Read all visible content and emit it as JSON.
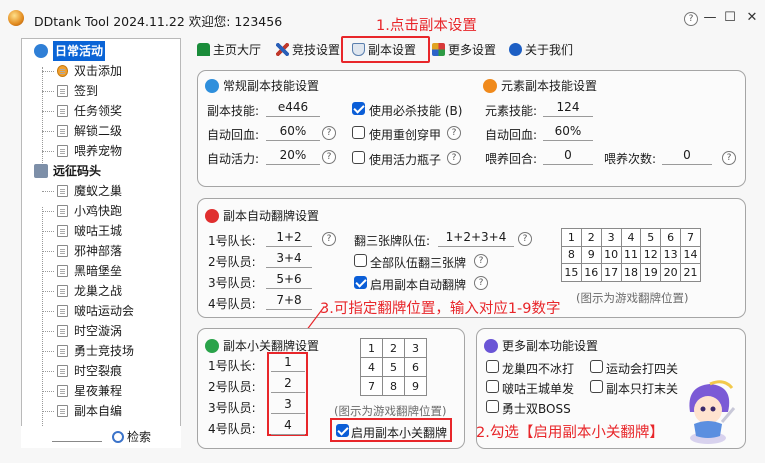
{
  "window": {
    "title": "DDtank Tool 2024.11.22 欢迎您: 123456",
    "help_glyph": "?",
    "minimize_glyph": "—",
    "maximize_glyph": "☐",
    "close_glyph": "✕"
  },
  "annotations": {
    "step1": "1.点击副本设置",
    "step2": "2.勾选【启用副本小关翻牌】",
    "step3": "3.可指定翻牌位置，输入对应1-9数字"
  },
  "sidebar": {
    "groups": [
      {
        "label": "日常活动",
        "selected": true,
        "items": [
          "双击添加",
          "签到",
          "任务领奖",
          "解锁二级",
          "喂养宠物"
        ]
      },
      {
        "label": "远征码头",
        "selected": false,
        "items": [
          "魔蚁之巢",
          "小鸡快跑",
          "啵咕王城",
          "邪神部落",
          "黑暗堡垒",
          "龙巢之战",
          "啵咕运动会",
          "时空漩涡",
          "勇士竞技场",
          "时空裂痕",
          "星夜兼程",
          "副本自编"
        ]
      }
    ],
    "search_label": "检索"
  },
  "tabs": [
    {
      "label": "主页大厅",
      "icon": "home-icon",
      "color": "#1a8c3a"
    },
    {
      "label": "竞技设置",
      "icon": "crossed-swords-icon",
      "color": "#2a5fb8"
    },
    {
      "label": "副本设置",
      "icon": "ship-icon",
      "color": "#5a7fae",
      "active": true
    },
    {
      "label": "更多设置",
      "icon": "grid-icon",
      "color": "#4a4a4a"
    },
    {
      "label": "关于我们",
      "icon": "info-icon",
      "color": "#1d5fc4"
    }
  ],
  "regular_skills": {
    "title": "常规副本技能设置",
    "skill_label": "副本技能:",
    "skill_value": "e446",
    "auto_hp_label": "自动回血:",
    "auto_hp_value": "60%",
    "auto_energy_label": "自动活力:",
    "auto_energy_value": "20%",
    "use_kill_skill": {
      "label": "使用必杀技能 (B)",
      "checked": true
    },
    "use_armor_pierce": {
      "label": "使用重创穿甲",
      "checked": false
    },
    "use_energy_bottle": {
      "label": "使用活力瓶子",
      "checked": false
    }
  },
  "element_skills": {
    "title": "元素副本技能设置",
    "skill_label": "元素技能:",
    "skill_value": "124",
    "auto_hp_label": "自动回血:",
    "auto_hp_value": "60%",
    "feed_round_label": "喂养回合:",
    "feed_round_value": "0",
    "feed_count_label": "喂养次数:",
    "feed_count_value": "0"
  },
  "auto_flip": {
    "title": "副本自动翻牌设置",
    "rows": [
      {
        "label": "1号队长:",
        "value": "1+2"
      },
      {
        "label": "2号队员:",
        "value": "3+4"
      },
      {
        "label": "3号队员:",
        "value": "5+6"
      },
      {
        "label": "4号队员:",
        "value": "7+8"
      }
    ],
    "triple_label": "翻三张牌队伍:",
    "triple_value": "1+2+3+4",
    "all_triple": {
      "label": "全部队伍翻三张牌",
      "checked": false
    },
    "enable_auto": {
      "label": "启用副本自动翻牌",
      "checked": true
    },
    "grid": [
      [
        1,
        2,
        3,
        4,
        5,
        6,
        7
      ],
      [
        8,
        9,
        10,
        11,
        12,
        13,
        14
      ],
      [
        15,
        16,
        17,
        18,
        19,
        20,
        21
      ]
    ],
    "grid_note": "(图示为游戏翻牌位置)"
  },
  "mini_flip": {
    "title": "副本小关翻牌设置",
    "rows": [
      {
        "label": "1号队长:",
        "value": "1"
      },
      {
        "label": "2号队员:",
        "value": "2"
      },
      {
        "label": "3号队员:",
        "value": "3"
      },
      {
        "label": "4号队员:",
        "value": "4"
      }
    ],
    "grid": [
      [
        1,
        2,
        3
      ],
      [
        4,
        5,
        6
      ],
      [
        7,
        8,
        9
      ]
    ],
    "grid_note": "(图示为游戏翻牌位置)",
    "enable": {
      "label": "启用副本小关翻牌",
      "checked": true
    }
  },
  "more_features": {
    "title": "更多副本功能设置",
    "options": [
      {
        "label": "龙巢四不冰打",
        "checked": false
      },
      {
        "label": "运动会打四关",
        "checked": false
      },
      {
        "label": "啵咕王城单发",
        "checked": false
      },
      {
        "label": "副本只打末关",
        "checked": false
      },
      {
        "label": "勇士双BOSS",
        "checked": false
      }
    ]
  },
  "colors": {
    "accent": "#0b5ed7",
    "annotation_red": "#e8262a",
    "selection": "#0a64d6"
  }
}
